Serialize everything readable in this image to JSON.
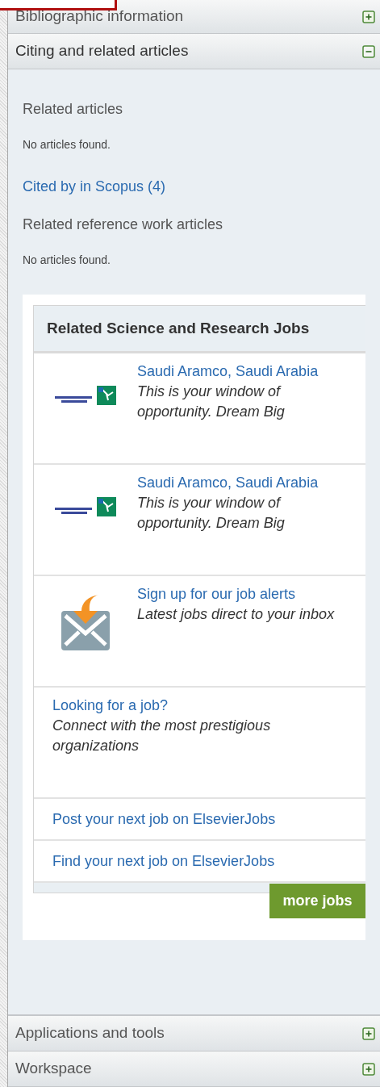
{
  "sections_top": [
    {
      "title": "Bibliographic information",
      "expanded": false
    },
    {
      "title": "Citing and related articles",
      "expanded": true
    }
  ],
  "content": [
    {
      "kind": "heading",
      "text": "Related articles"
    },
    {
      "kind": "note",
      "text": "No articles found."
    },
    {
      "kind": "link",
      "text": "Cited by in Scopus (4)"
    },
    {
      "kind": "heading",
      "text": "Related reference work articles"
    },
    {
      "kind": "note",
      "text": "No articles found."
    }
  ],
  "jobs": {
    "title": "Related Science and Research Jobs",
    "items": [
      {
        "kind": "job",
        "link": "Saudi Aramco, Saudi Arabia",
        "tagline": "This is your window of opportunity. Dream Big"
      },
      {
        "kind": "job",
        "link": "Saudi Aramco, Saudi Arabia",
        "tagline": "This is your window of opportunity. Dream Big"
      },
      {
        "kind": "alert",
        "link": "Sign up for our job alerts",
        "tagline": "Latest jobs direct to your inbox"
      },
      {
        "kind": "text",
        "link": "Looking for a job?",
        "tagline": "Connect with the most prestigious organizations"
      },
      {
        "kind": "link",
        "link": "Post your next job on ElsevierJobs"
      },
      {
        "kind": "link",
        "link": "Find your next job on ElsevierJobs"
      }
    ],
    "more_button": "more jobs"
  },
  "sections_bottom": [
    {
      "title": "Applications and tools",
      "expanded": false
    },
    {
      "title": "Workspace",
      "expanded": false
    }
  ]
}
